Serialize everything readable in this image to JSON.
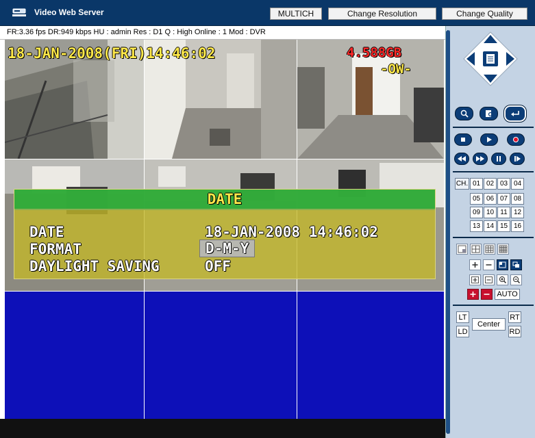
{
  "window": {
    "title": "Video Web Server"
  },
  "toolbar": {
    "multich_label": "MULTICH",
    "resolution_label": "Change Resolution",
    "quality_label": "Change Quality"
  },
  "status": {
    "text": "FR:3.36 fps  DR:949 kbps  HU : admin  Res : D1  Q : High  Online : 1 Mod : DVR"
  },
  "video": {
    "osd_datetime": "18-JAN-2008(FRI)14:46:02",
    "osd_storage": "4.588GB",
    "osd_mode": "-OW-"
  },
  "osd_menu": {
    "title": "DATE",
    "rows": [
      {
        "label": "DATE",
        "value": "18-JAN-2008 14:46:02"
      },
      {
        "label": "FORMAT",
        "value": "D-M-Y"
      },
      {
        "label": "DAYLIGHT SAVING",
        "value": "OFF"
      }
    ]
  },
  "channels": {
    "label": "CH.",
    "items": [
      "01",
      "02",
      "03",
      "04",
      "05",
      "06",
      "07",
      "08",
      "09",
      "10",
      "11",
      "12",
      "13",
      "14",
      "15",
      "16"
    ]
  },
  "ptz": {
    "auto_label": "AUTO",
    "center_label": "Center",
    "lt_label": "LT",
    "ld_label": "LD",
    "rt_label": "RT",
    "rd_label": "RD"
  },
  "colors": {
    "titlebar": "#0a3768",
    "panel": "#c4d3e4",
    "button_blue": "#0c3d77",
    "video_empty": "#0d10b8",
    "osd_yellow": "#ffe94a",
    "osd_red": "#ff2a2a",
    "menu_header_green": "#28aa3c"
  },
  "icons": {
    "logo": "dvr-logo-icon",
    "ptz": "ptz-direction-pad-icon",
    "search": "search-icon",
    "search_record": "search-record-icon",
    "back": "return-icon",
    "stop": "stop-icon",
    "play": "play-icon",
    "record": "record-icon",
    "rewind": "rewind-icon",
    "fast_forward": "fast-forward-icon",
    "pause": "pause-icon",
    "step": "step-forward-icon"
  }
}
